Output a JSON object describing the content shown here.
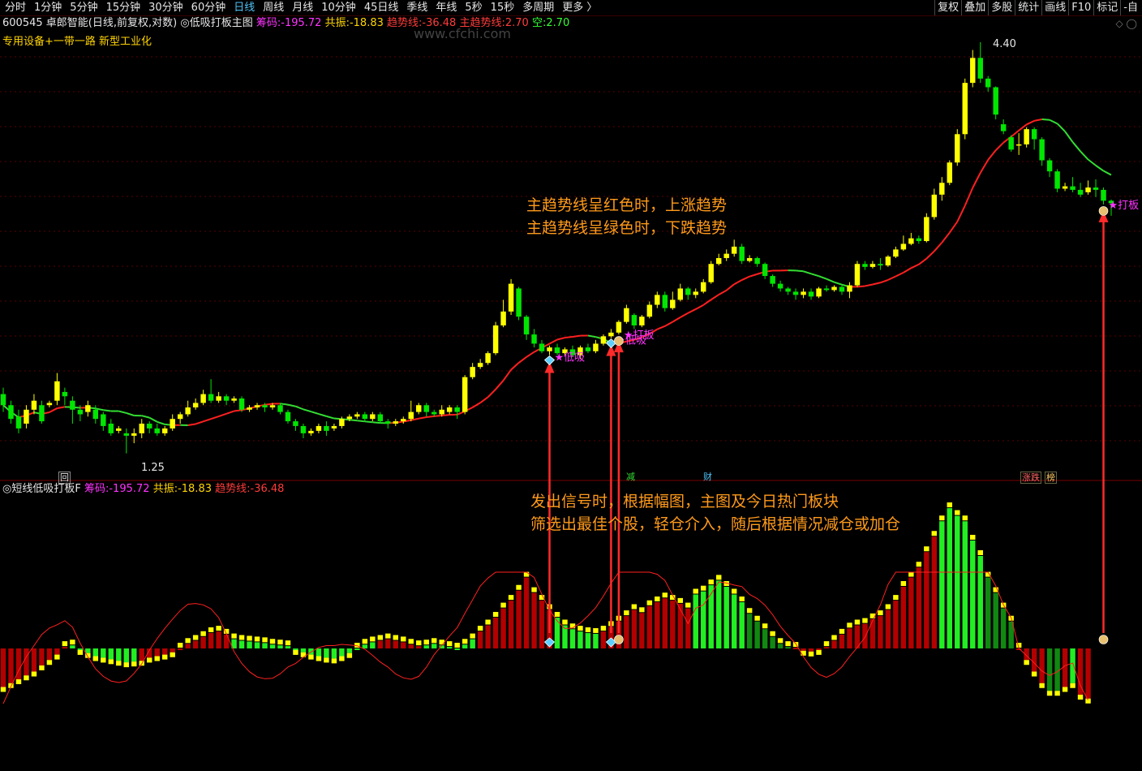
{
  "toolbar": {
    "periods": [
      "分时",
      "1分钟",
      "5分钟",
      "15分钟",
      "30分钟",
      "60分钟",
      "日线",
      "周线",
      "月线",
      "10分钟",
      "45日线",
      "季线",
      "年线",
      "5秒",
      "15秒",
      "多周期",
      "更多 〉"
    ],
    "active_period": "日线",
    "right_buttons": [
      "复权",
      "叠加",
      "多股",
      "统计",
      "画线",
      "F10",
      "标记",
      "-自"
    ]
  },
  "main_panel": {
    "stock_code": "600545",
    "stock_name": "卓郎智能",
    "mode": "(日线,前复权,对数)",
    "indicator_name": "低吸打板主图",
    "chouma_label": "筹码:",
    "chouma_value": "-195.72",
    "gongzhen_label": "共振:",
    "gongzhen_value": "-18.83",
    "trend_label": "趋势线:",
    "trend_value": "-36.48",
    "main_trend_label": "主趋势线:",
    "main_trend_value": "2.70",
    "kong_label": "空:",
    "kong_value": "2.70",
    "sector": "专用设备+一带一路 新型工业化",
    "watermark": "www.cfchi.com",
    "max_price_label": "4.40",
    "min_price_label": "1.25",
    "signal_dixi": "低吸",
    "signal_daban": "打板",
    "bottom_markers": [
      "回",
      "减",
      "财",
      "涨跌",
      "榜"
    ]
  },
  "annotations": {
    "trend_note_line1": "主趋势线呈红色时，上涨趋势",
    "trend_note_line2": "主趋势线呈绿色时，下跌趋势",
    "signal_note_line1": "发出信号时，根据幅图，主图及今日热门板块",
    "signal_note_line2": "筛选出最佳个股，轻仓介入，随后根据情况减仓或加仓"
  },
  "sub_panel": {
    "indicator_name": "短线低吸打板F",
    "chouma_label": "筹码:",
    "chouma_value": "-195.72",
    "gongzhen_label": "共振:",
    "gongzhen_value": "-18.83",
    "trend_label": "趋势线:",
    "trend_value": "-36.48"
  },
  "colors": {
    "up_candle": "#ffff00",
    "down_candle": "#00e600",
    "trend_up": "#ff2020",
    "trend_down": "#33dd33",
    "bar_red": "#b30000",
    "bar_green": "#22ee22",
    "bar_darkgreen": "#118811",
    "arrow": "#ff2a2a",
    "note": "#ff9a1a"
  },
  "chart_data": {
    "type": "candlestick",
    "candles": [
      [
        1.55,
        1.5,
        1.58,
        1.47
      ],
      [
        1.5,
        1.44,
        1.52,
        1.42
      ],
      [
        1.45,
        1.4,
        1.48,
        1.38
      ],
      [
        1.42,
        1.48,
        1.5,
        1.4
      ],
      [
        1.48,
        1.52,
        1.55,
        1.46
      ],
      [
        1.5,
        1.43,
        1.52,
        1.42
      ],
      [
        1.5,
        1.51,
        1.52,
        1.49
      ],
      [
        1.52,
        1.61,
        1.65,
        1.5
      ],
      [
        1.56,
        1.54,
        1.58,
        1.5
      ],
      [
        1.52,
        1.48,
        1.54,
        1.42
      ],
      [
        1.48,
        1.46,
        1.5,
        1.43
      ],
      [
        1.47,
        1.5,
        1.52,
        1.45
      ],
      [
        1.48,
        1.44,
        1.5,
        1.42
      ],
      [
        1.46,
        1.41,
        1.47,
        1.39
      ],
      [
        1.42,
        1.38,
        1.44,
        1.37
      ],
      [
        1.39,
        1.4,
        1.41,
        1.38
      ],
      [
        1.38,
        1.37,
        1.4,
        1.3
      ],
      [
        1.37,
        1.38,
        1.4,
        1.34
      ],
      [
        1.38,
        1.42,
        1.44,
        1.36
      ],
      [
        1.42,
        1.4,
        1.43,
        1.38
      ],
      [
        1.4,
        1.38,
        1.42,
        1.37
      ],
      [
        1.38,
        1.4,
        1.41,
        1.37
      ],
      [
        1.4,
        1.44,
        1.46,
        1.39
      ],
      [
        1.44,
        1.46,
        1.47,
        1.42
      ],
      [
        1.46,
        1.49,
        1.52,
        1.45
      ],
      [
        1.49,
        1.51,
        1.53,
        1.48
      ],
      [
        1.51,
        1.55,
        1.57,
        1.5
      ],
      [
        1.55,
        1.52,
        1.62,
        1.51
      ],
      [
        1.52,
        1.54,
        1.56,
        1.51
      ],
      [
        1.54,
        1.52,
        1.55,
        1.5
      ],
      [
        1.52,
        1.53,
        1.54,
        1.51
      ],
      [
        1.53,
        1.48,
        1.54,
        1.47
      ],
      [
        1.48,
        1.49,
        1.5,
        1.47
      ],
      [
        1.49,
        1.5,
        1.51,
        1.48
      ],
      [
        1.5,
        1.49,
        1.51,
        1.47
      ],
      [
        1.49,
        1.5,
        1.51,
        1.48
      ],
      [
        1.5,
        1.47,
        1.51,
        1.46
      ],
      [
        1.47,
        1.43,
        1.48,
        1.42
      ],
      [
        1.43,
        1.41,
        1.44,
        1.39
      ],
      [
        1.41,
        1.38,
        1.42,
        1.36
      ],
      [
        1.38,
        1.39,
        1.4,
        1.37
      ],
      [
        1.39,
        1.41,
        1.42,
        1.38
      ],
      [
        1.41,
        1.39,
        1.43,
        1.37
      ],
      [
        1.4,
        1.41,
        1.42,
        1.39
      ],
      [
        1.41,
        1.44,
        1.45,
        1.4
      ],
      [
        1.44,
        1.45,
        1.46,
        1.43
      ],
      [
        1.45,
        1.46,
        1.47,
        1.44
      ],
      [
        1.46,
        1.44,
        1.47,
        1.43
      ],
      [
        1.44,
        1.46,
        1.47,
        1.43
      ],
      [
        1.46,
        1.43,
        1.47,
        1.42
      ],
      [
        1.43,
        1.42,
        1.44,
        1.4
      ],
      [
        1.42,
        1.43,
        1.44,
        1.41
      ],
      [
        1.43,
        1.44,
        1.45,
        1.42
      ],
      [
        1.44,
        1.47,
        1.52,
        1.43
      ],
      [
        1.47,
        1.5,
        1.51,
        1.46
      ],
      [
        1.5,
        1.47,
        1.51,
        1.45
      ],
      [
        1.47,
        1.46,
        1.48,
        1.45
      ],
      [
        1.46,
        1.48,
        1.5,
        1.45
      ],
      [
        1.47,
        1.49,
        1.5,
        1.46
      ],
      [
        1.49,
        1.47,
        1.5,
        1.44
      ],
      [
        1.47,
        1.63,
        1.64,
        1.46
      ],
      [
        1.63,
        1.68,
        1.7,
        1.62
      ],
      [
        1.68,
        1.7,
        1.72,
        1.67
      ],
      [
        1.7,
        1.75,
        1.76,
        1.69
      ],
      [
        1.75,
        1.9,
        1.92,
        1.74
      ],
      [
        1.9,
        1.98,
        2.05,
        1.89
      ],
      [
        1.98,
        2.15,
        2.18,
        1.96
      ],
      [
        2.12,
        1.95,
        2.13,
        1.93
      ],
      [
        1.95,
        1.85,
        1.96,
        1.82
      ],
      [
        1.85,
        1.8,
        1.88,
        1.78
      ],
      [
        1.8,
        1.76,
        1.82,
        1.75
      ],
      [
        1.76,
        1.78,
        1.79,
        1.74
      ],
      [
        1.78,
        1.75,
        1.8,
        1.74
      ],
      [
        1.75,
        1.77,
        1.78,
        1.74
      ],
      [
        1.77,
        1.74,
        1.79,
        1.73
      ],
      [
        1.74,
        1.78,
        1.79,
        1.72
      ],
      [
        1.78,
        1.76,
        1.8,
        1.75
      ],
      [
        1.76,
        1.8,
        1.82,
        1.75
      ],
      [
        1.8,
        1.84,
        1.85,
        1.79
      ],
      [
        1.84,
        1.86,
        1.88,
        1.83
      ],
      [
        1.86,
        1.92,
        1.93,
        1.85
      ],
      [
        1.92,
        2.0,
        2.02,
        1.91
      ],
      [
        1.96,
        1.9,
        1.97,
        1.88
      ],
      [
        1.9,
        1.95,
        1.96,
        1.89
      ],
      [
        1.95,
        2.02,
        2.04,
        1.94
      ],
      [
        2.02,
        2.08,
        2.1,
        2.0
      ],
      [
        2.08,
        2.0,
        2.1,
        1.98
      ],
      [
        2.0,
        2.05,
        2.1,
        1.99
      ],
      [
        2.05,
        2.12,
        2.15,
        2.04
      ],
      [
        2.12,
        2.08,
        2.13,
        2.05
      ],
      [
        2.08,
        2.1,
        2.12,
        2.06
      ],
      [
        2.1,
        2.16,
        2.18,
        2.09
      ],
      [
        2.16,
        2.28,
        2.3,
        2.15
      ],
      [
        2.28,
        2.32,
        2.35,
        2.27
      ],
      [
        2.32,
        2.35,
        2.38,
        2.3
      ],
      [
        2.35,
        2.4,
        2.45,
        2.33
      ],
      [
        2.4,
        2.3,
        2.42,
        2.28
      ],
      [
        2.3,
        2.32,
        2.34,
        2.29
      ],
      [
        2.32,
        2.28,
        2.33,
        2.26
      ],
      [
        2.28,
        2.2,
        2.29,
        2.18
      ],
      [
        2.2,
        2.15,
        2.21,
        2.13
      ],
      [
        2.15,
        2.12,
        2.17,
        2.1
      ],
      [
        2.12,
        2.1,
        2.13,
        2.08
      ],
      [
        2.1,
        2.08,
        2.12,
        2.05
      ],
      [
        2.08,
        2.1,
        2.12,
        2.06
      ],
      [
        2.1,
        2.07,
        2.12,
        2.05
      ],
      [
        2.07,
        2.12,
        2.13,
        2.06
      ],
      [
        2.12,
        2.11,
        2.14,
        2.1
      ],
      [
        2.11,
        2.13,
        2.14,
        2.1
      ],
      [
        2.13,
        2.1,
        2.14,
        2.08
      ],
      [
        2.1,
        2.14,
        2.16,
        2.06
      ],
      [
        2.14,
        2.28,
        2.3,
        2.13
      ],
      [
        2.28,
        2.26,
        2.3,
        2.24
      ],
      [
        2.26,
        2.28,
        2.3,
        2.25
      ],
      [
        2.28,
        2.27,
        2.32,
        2.24
      ],
      [
        2.27,
        2.33,
        2.34,
        2.26
      ],
      [
        2.33,
        2.38,
        2.4,
        2.32
      ],
      [
        2.38,
        2.42,
        2.48,
        2.37
      ],
      [
        2.42,
        2.46,
        2.5,
        2.41
      ],
      [
        2.46,
        2.44,
        2.48,
        2.42
      ],
      [
        2.44,
        2.62,
        2.65,
        2.43
      ],
      [
        2.62,
        2.8,
        2.85,
        2.6
      ],
      [
        2.8,
        2.9,
        2.95,
        2.75
      ],
      [
        2.9,
        3.08,
        3.1,
        2.88
      ],
      [
        3.08,
        3.35,
        3.4,
        3.05
      ],
      [
        3.35,
        3.9,
        3.95,
        3.3
      ],
      [
        3.9,
        4.2,
        4.3,
        3.85
      ],
      [
        4.2,
        3.95,
        4.4,
        3.9
      ],
      [
        3.95,
        3.85,
        3.98,
        3.8
      ],
      [
        3.85,
        3.55,
        3.86,
        3.5
      ],
      [
        3.45,
        3.38,
        3.5,
        3.35
      ],
      [
        3.32,
        3.2,
        3.34,
        3.18
      ],
      [
        3.24,
        3.25,
        3.36,
        3.15
      ],
      [
        3.25,
        3.4,
        3.42,
        3.22
      ],
      [
        3.4,
        3.3,
        3.42,
        3.2
      ],
      [
        3.3,
        3.1,
        3.32,
        3.05
      ],
      [
        3.1,
        3.0,
        3.12,
        2.95
      ],
      [
        3.0,
        2.85,
        3.02,
        2.82
      ],
      [
        2.85,
        2.87,
        2.9,
        2.83
      ],
      [
        2.87,
        2.84,
        2.95,
        2.82
      ],
      [
        2.84,
        2.8,
        2.9,
        2.78
      ],
      [
        2.82,
        2.86,
        2.92,
        2.8
      ],
      [
        2.86,
        2.84,
        2.93,
        2.78
      ],
      [
        2.84,
        2.75,
        2.86,
        2.72
      ],
      [
        2.75,
        2.73,
        2.76,
        2.63
      ]
    ],
    "osc_values": [
      -0.5,
      -0.45,
      -0.4,
      -0.35,
      -0.3,
      -0.22,
      -0.15,
      -0.08,
      0.02,
      0.04,
      -0.02,
      -0.06,
      -0.1,
      -0.12,
      -0.14,
      -0.16,
      -0.18,
      -0.17,
      -0.16,
      -0.12,
      -0.1,
      -0.08,
      -0.05,
      0.0,
      0.06,
      0.1,
      0.15,
      0.2,
      0.22,
      0.18,
      0.12,
      0.1,
      0.09,
      0.08,
      0.07,
      0.05,
      0.04,
      0.03,
      -0.02,
      -0.05,
      -0.08,
      -0.1,
      -0.12,
      -0.13,
      -0.1,
      -0.06,
      0.0,
      0.05,
      0.08,
      0.1,
      0.12,
      0.1,
      0.08,
      0.05,
      0.03,
      0.04,
      0.06,
      0.04,
      0.02,
      0.0,
      0.05,
      0.12,
      0.22,
      0.3,
      0.4,
      0.52,
      0.62,
      0.75,
      0.92,
      0.72,
      0.62,
      0.5,
      0.4,
      0.3,
      0.25,
      0.22,
      0.2,
      0.19,
      0.22,
      0.28,
      0.35,
      0.42,
      0.5,
      0.46,
      0.55,
      0.6,
      0.65,
      0.62,
      0.58,
      0.52,
      0.7,
      0.74,
      0.82,
      0.88,
      0.8,
      0.7,
      0.6,
      0.45,
      0.35,
      0.25,
      0.15,
      0.06,
      0.02,
      0.01,
      -0.03,
      -0.04,
      -0.02,
      0.02,
      0.1,
      0.18,
      0.26,
      0.3,
      0.32,
      0.38,
      0.42,
      0.5,
      0.62,
      0.8,
      0.92,
      1.05,
      1.25,
      1.45,
      1.65,
      1.82,
      1.72,
      1.65,
      1.4,
      1.2,
      0.92,
      0.72,
      0.52,
      0.35,
      0.0,
      -0.15,
      -0.3,
      -0.45,
      -0.55,
      -0.55,
      -0.5,
      -0.45,
      -0.6,
      -0.65
    ],
    "osc_colors": "rrrrrrrrrgggggggggrrrrrrrrrrrrgggggggggggggggggggrrrrrrgggggggrrrrrrrrrrggggggrrrrrrrrrrrrgggggggddddddrrrrrrrrrrrrrrrrrrrggggggddddrrrrddrg",
    "signals_dixi": [
      71,
      79
    ],
    "signals_daban": [
      80,
      143
    ],
    "arrows_at": [
      71,
      79,
      80,
      143
    ]
  }
}
